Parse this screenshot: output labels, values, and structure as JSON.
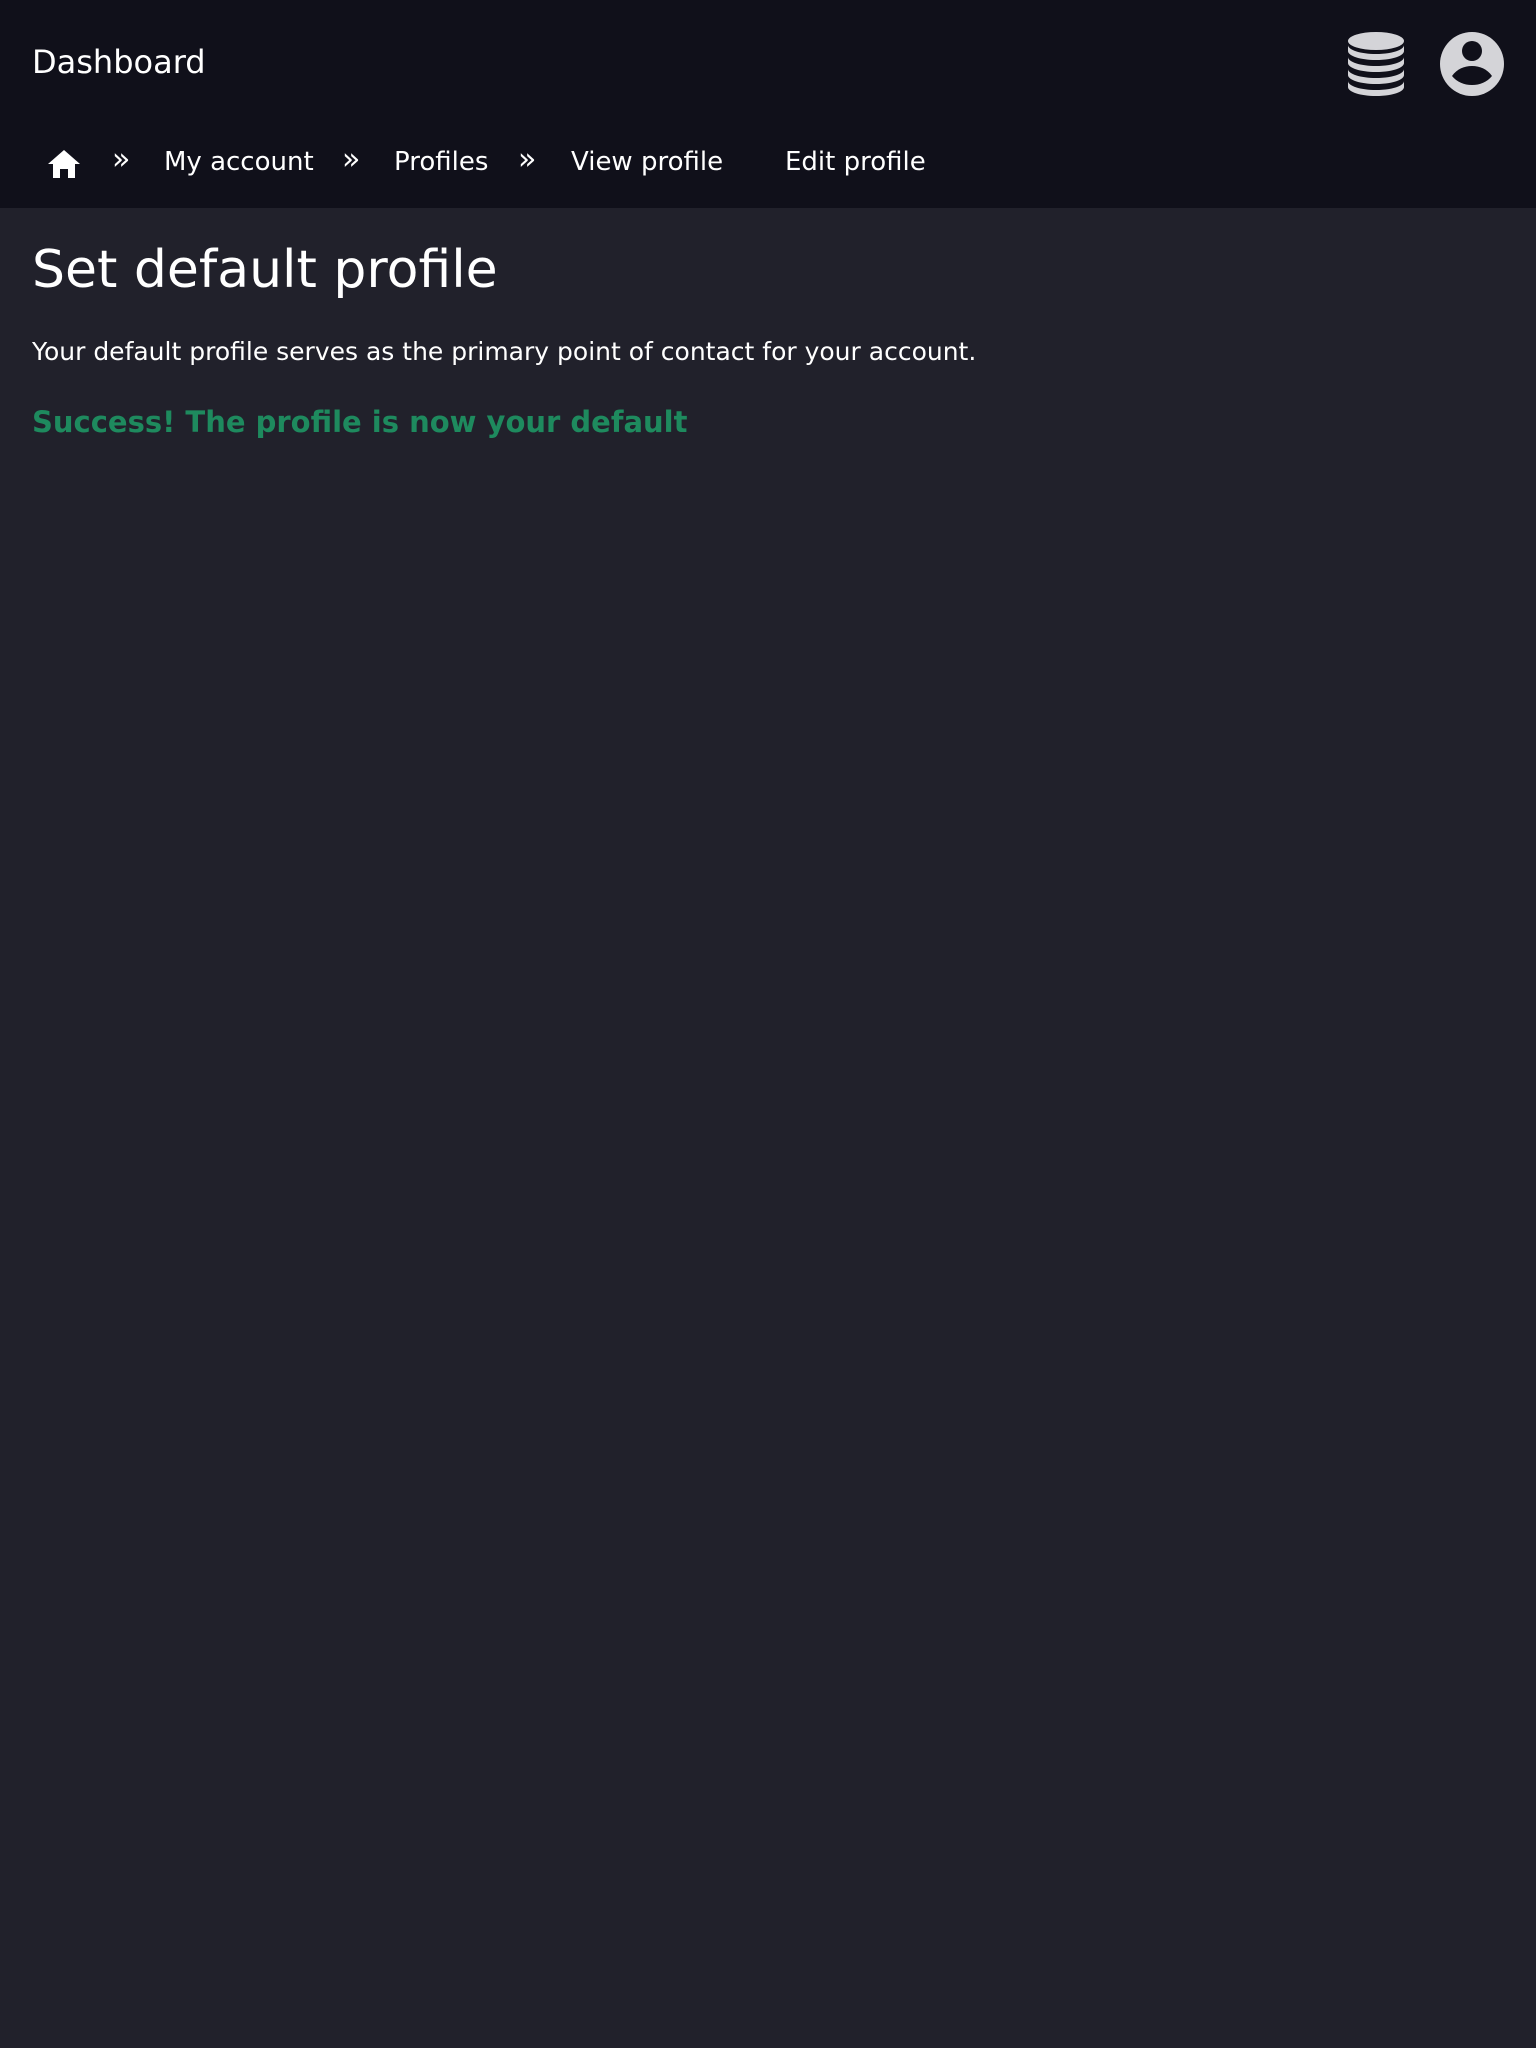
{
  "header": {
    "app_title": "Dashboard",
    "database_icon": "database-icon",
    "account_icon": "user-circle-icon"
  },
  "breadcrumb": {
    "home_icon": "home-icon",
    "separator": "»",
    "items": [
      {
        "label": "My account"
      },
      {
        "label": "Profiles"
      },
      {
        "label": "View profile"
      }
    ],
    "extra_link": "Edit profile"
  },
  "main": {
    "title": "Set default profile",
    "description": "Your default profile serves as the primary point of contact for your account.",
    "success_message": "Success! The profile is now your default"
  },
  "colors": {
    "header_bg": "#10101a",
    "page_bg": "#21212b",
    "text": "#ffffff",
    "success": "#1e8a5e",
    "icon": "#d4d4d8"
  }
}
